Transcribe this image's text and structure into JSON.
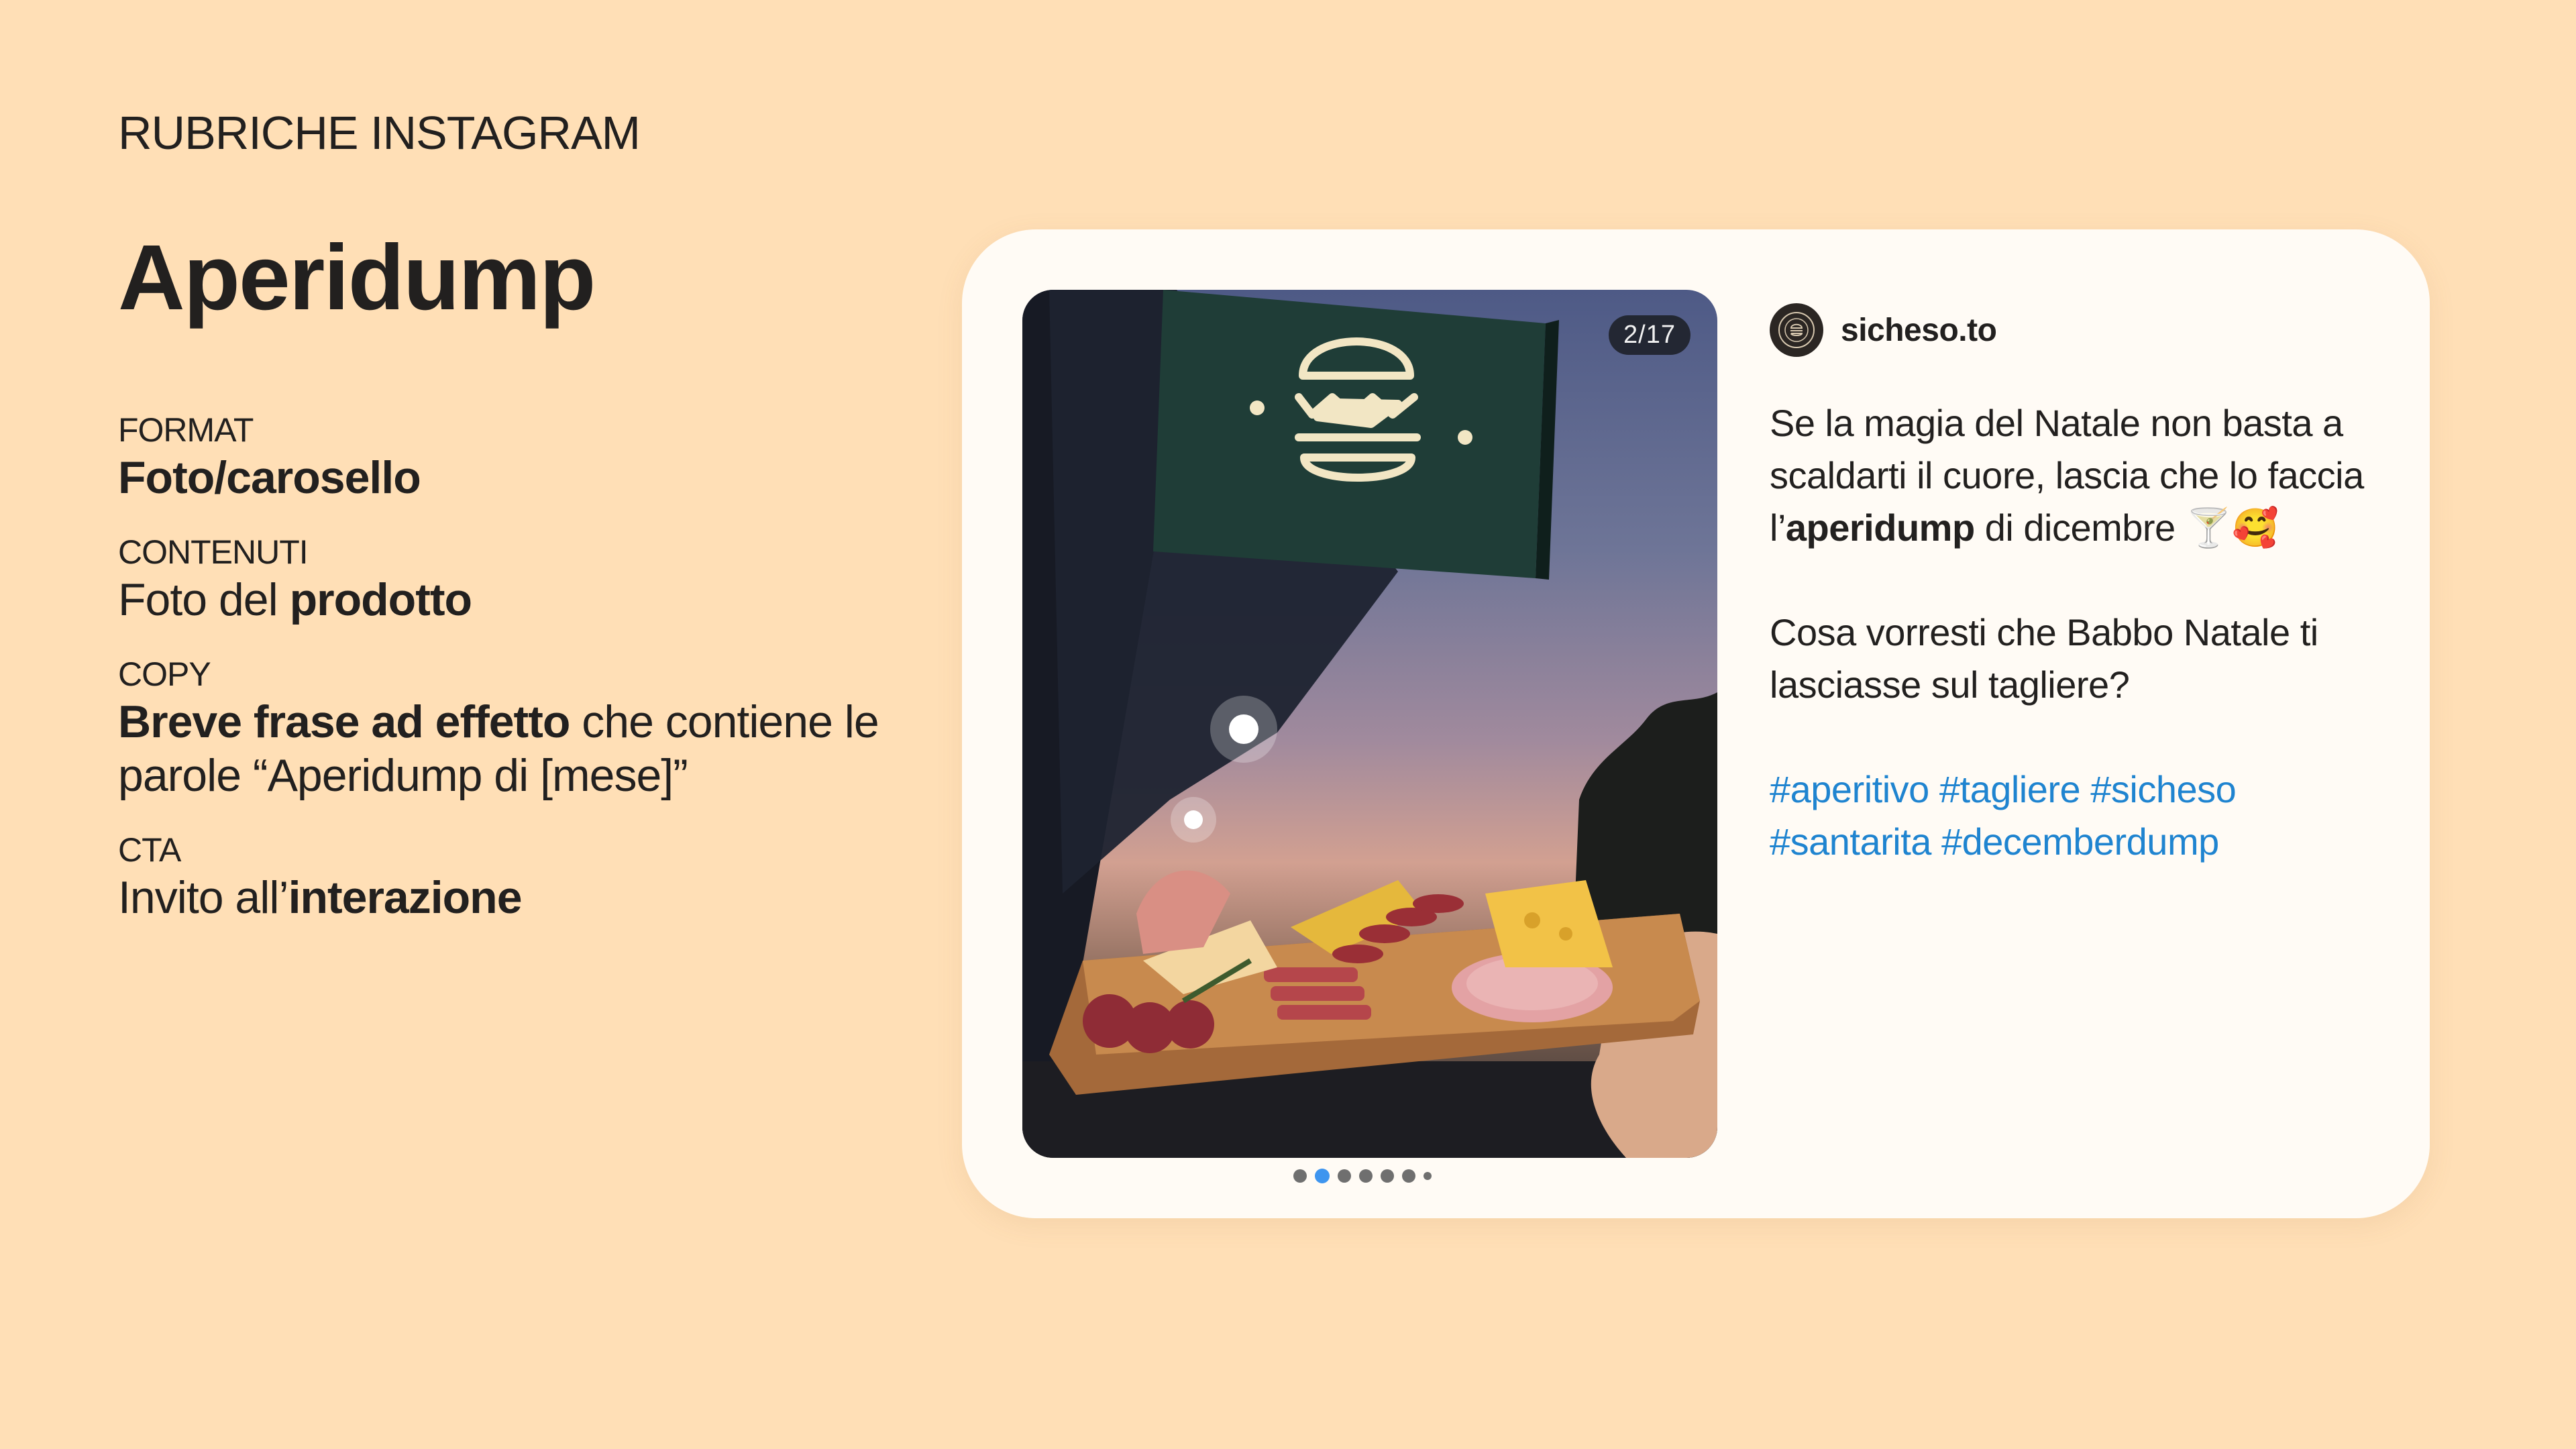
{
  "header": {
    "rubric_title": "RUBRICHE INSTAGRAM",
    "section_title": "Aperidump"
  },
  "specs": {
    "format": {
      "label": "FORMAT",
      "value_bold": "Foto/carosello"
    },
    "contents": {
      "label": "CONTENUTI",
      "value_prefix": "Foto del ",
      "value_bold": "prodotto"
    },
    "copy": {
      "label": "COPY",
      "value_bold": "Breve frase ad effetto",
      "value_rest": " che contiene le parole “Aperidump di [mese]”"
    },
    "cta": {
      "label": "CTA",
      "value_prefix": "Invito all’",
      "value_bold": "interazione"
    }
  },
  "post": {
    "username": "sicheso.to",
    "image_counter": "2/17",
    "carousel": {
      "total_dots": 7,
      "active_index": 1
    },
    "caption": {
      "line1": "Se la magia del Natale non basta a scaldarti il cuore, lascia che lo faccia l’",
      "line1_bold": "aperidump",
      "line1_end": " di dicembre 🍸🥰",
      "line2": "Cosa vorresti che Babbo Natale ti lasciasse sul tagliere?"
    },
    "hashtags": "#aperitivo #tagliere #sicheso #santarita #decemberdump"
  },
  "colors": {
    "background": "#FFDFB6",
    "card": "#FFFBF5",
    "hashtag": "#1F84D0",
    "active_dot": "#3E95EF"
  }
}
